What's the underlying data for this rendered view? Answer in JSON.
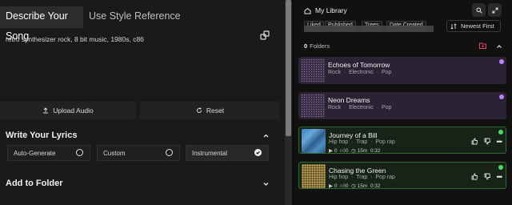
{
  "left": {
    "tabs": [
      {
        "label": "Describe Your Song"
      },
      {
        "label": "Use Style Reference"
      }
    ],
    "prompt": "retro synthesizer rock, 8 bit music, 1980s, c86",
    "upload_label": "Upload Audio",
    "reset_label": "Reset",
    "lyrics_heading": "Write Your Lyrics",
    "lyrics_options": [
      {
        "label": "Auto-Generate",
        "selected": false
      },
      {
        "label": "Custom",
        "selected": false
      },
      {
        "label": "Instrumental",
        "selected": true
      }
    ],
    "folder_heading": "Add to Folder"
  },
  "library": {
    "title": "My Library",
    "filters": [
      "Liked",
      "Published",
      "Trees",
      "Date Created"
    ],
    "sort_label": "Newest First",
    "folders_count": "0",
    "folders_label": "Folders",
    "songs": [
      {
        "title": "Echoes of Tomorrow",
        "tags": [
          "Rock",
          "Electronic",
          "Pop"
        ],
        "color": "purple"
      },
      {
        "title": "Neon Dreams",
        "tags": [
          "Rock",
          "Electronic",
          "Pop"
        ],
        "color": "purple"
      },
      {
        "title": "Journey of a Bill",
        "tags": [
          "Hip hop",
          "Trap",
          "Pop rap"
        ],
        "plays": "0",
        "likes": "0",
        "age": "15m",
        "duration": "0:32",
        "color": "green"
      },
      {
        "title": "Chasing the Green",
        "tags": [
          "Hip hop",
          "Trap",
          "Pop rap"
        ],
        "plays": "0",
        "likes": "0",
        "age": "15m",
        "duration": "0:32",
        "color": "green"
      }
    ]
  },
  "colors": {
    "accent_purple": "#b684ff",
    "accent_green": "#4cd964",
    "folder_icon": "#e0476b"
  }
}
